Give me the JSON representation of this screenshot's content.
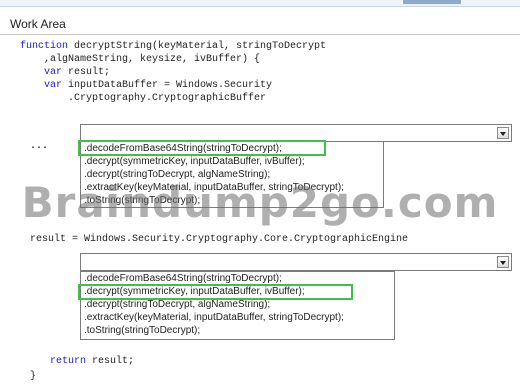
{
  "window": {
    "title": "Work Area"
  },
  "code": {
    "line1_kw": "function",
    "line1_rest": " decryptString(keyMaterial, stringToDecrypt",
    "line2": "    ,algNameString, keysize, ivBuffer) {",
    "line3_kw": "var",
    "line3_rest": " result;",
    "line4_kw": "var",
    "line4_rest": " inputDataBuffer = Windows.Security",
    "line5": "        .Cryptography.CryptographicBuffer",
    "ellipsis": "...",
    "result_line": "result = Windows.Security.Cryptography.Core.CryptographicEngine",
    "return_kw": "return",
    "return_rest": " result;",
    "closing": "}"
  },
  "dropdown1": {
    "options": [
      ".decodeFromBase64String(stringToDecrypt);",
      ".decrypt(symmetricKey, inputDataBuffer, ivBuffer);",
      ".decrypt(stringToDecrypt, algNameString);",
      ".extractKey(keyMaterial, inputDataBuffer, stringToDecrypt);",
      ".toString(stringToDecrypt);"
    ],
    "selected_index": 0
  },
  "dropdown2": {
    "options": [
      ".decodeFromBase64String(stringToDecrypt);",
      ".decrypt(symmetricKey, inputDataBuffer, ivBuffer);",
      ".decrypt(stringToDecrypt, algNameString);",
      ".extractKey(keyMaterial, inputDataBuffer, stringToDecrypt);",
      ".toString(stringToDecrypt);"
    ],
    "selected_index": 1
  },
  "watermark": {
    "text": "Braindump2go.com"
  },
  "colors": {
    "selection": "#3cc24a",
    "keyword": "#1b1bc8"
  }
}
